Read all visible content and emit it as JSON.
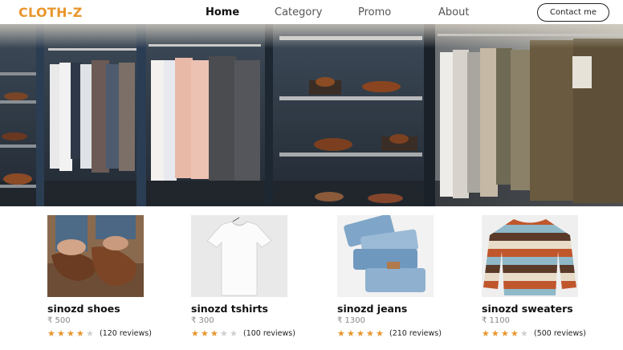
{
  "brand": {
    "name": "CLOTH-Z",
    "color": "#e8962c"
  },
  "nav": {
    "links": [
      {
        "label": "Home",
        "active": true
      },
      {
        "label": "Category",
        "active": false
      },
      {
        "label": "Promo",
        "active": false
      },
      {
        "label": "About",
        "active": false
      }
    ],
    "contact_label": "Contact me"
  },
  "hero": {
    "image": "clothing-store-interior"
  },
  "products": [
    {
      "name": "sinozd shoes",
      "price": "₹ 500",
      "rating": 4,
      "reviews": "(120 reviews)",
      "image": "brown-loafers"
    },
    {
      "name": "sinozd tshirts",
      "price": "₹ 300",
      "rating": 3,
      "reviews": "(100 reviews)",
      "image": "white-tshirt"
    },
    {
      "name": "sinozd jeans",
      "price": "₹ 1300",
      "rating": 5,
      "reviews": "(210 reviews)",
      "image": "folded-jeans"
    },
    {
      "name": "sinozd sweaters",
      "price": "₹ 1100",
      "rating": 4,
      "reviews": "(500 reviews)",
      "image": "striped-sweater"
    }
  ]
}
